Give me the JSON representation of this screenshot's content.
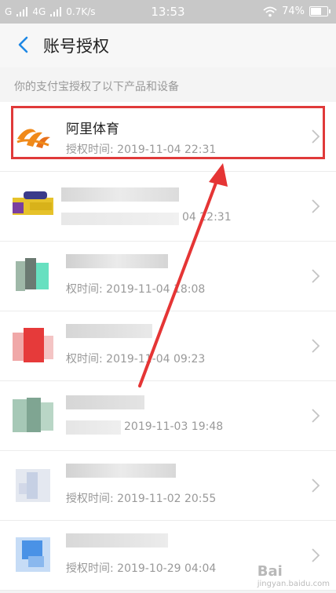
{
  "status_bar": {
    "network1": "G",
    "network2": "4G",
    "speed": "0.7K/s",
    "time": "13:53",
    "battery": "74%",
    "battery_level": 0.74
  },
  "nav": {
    "back_icon": "chevron-left-icon",
    "title": "账号授权"
  },
  "note": "你的支付宝授权了以下产品和设备",
  "rows": [
    {
      "name": "阿里体育",
      "time_label": "授权时间: ",
      "time": "2019-11-04 22:31",
      "obscured": false
    },
    {
      "name": "",
      "time_label": "",
      "time": "04 22:31",
      "obscured": true
    },
    {
      "name": "",
      "time_label": "权时间: ",
      "time": "2019-11-04 18:08",
      "obscured": true
    },
    {
      "name": "",
      "time_label": "权时间: ",
      "time": "2019-11-04 09:23",
      "obscured": true
    },
    {
      "name": "",
      "time_label": "",
      "time": "2019-11-03 19:48",
      "obscured": true
    },
    {
      "name": "",
      "time_label": "授权时间: ",
      "time": "2019-11-02 20:55",
      "obscured": true
    },
    {
      "name": "",
      "time_label": "授权时间: ",
      "time": "2019-10-29 04:04",
      "obscured": true
    }
  ],
  "watermark": {
    "text": "Bai",
    "sub": "jingyan.baidu.com"
  },
  "colors": {
    "highlight": "#e03a3a",
    "accent": "#1e88e5"
  }
}
